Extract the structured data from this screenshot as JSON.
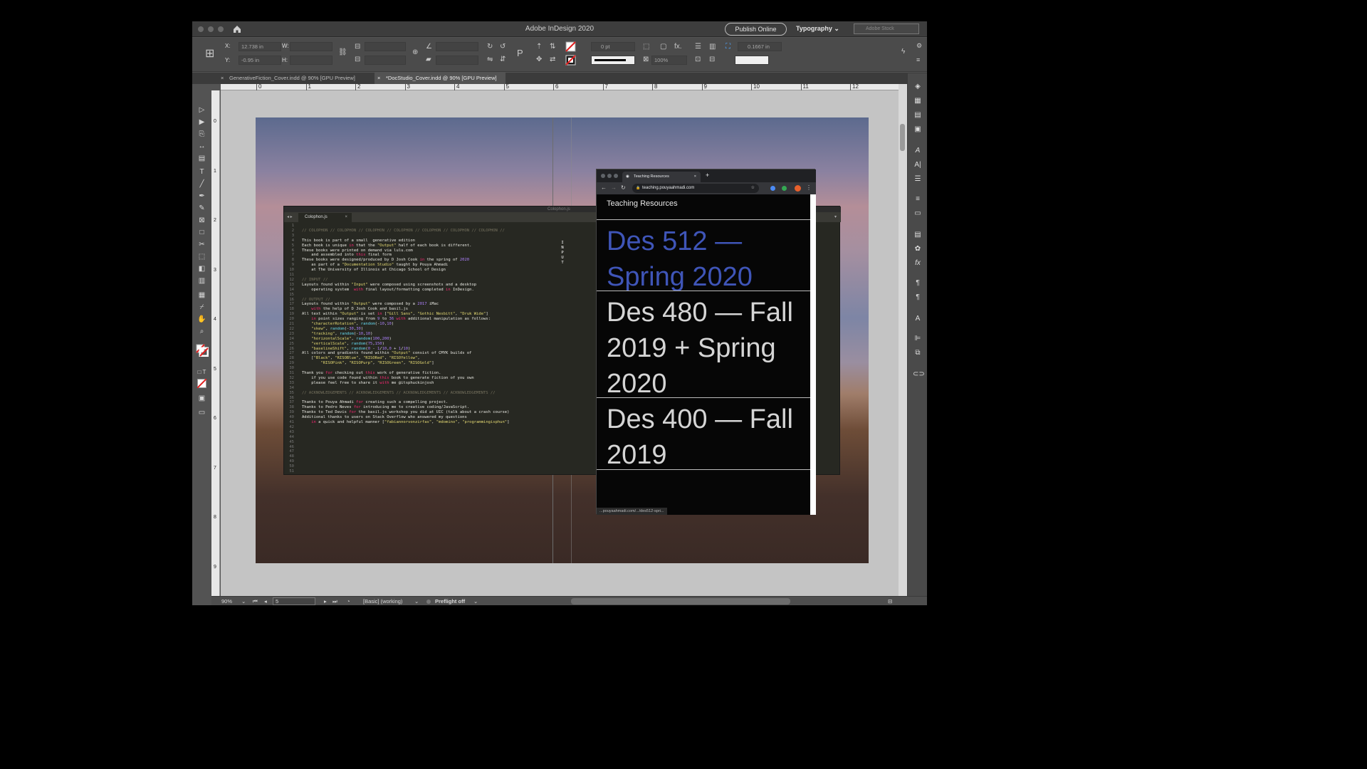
{
  "app": {
    "title": "Adobe InDesign 2020",
    "publish_label": "Publish Online",
    "workspace": "Typography",
    "stock_placeholder": "Adobe Stock"
  },
  "control": {
    "x_label": "X:",
    "x_value": "12.738 in",
    "y_label": "Y:",
    "y_value": "-0.95 in",
    "w_label": "W:",
    "h_label": "H:",
    "stroke_weight": "0 pt",
    "opacity": "100%",
    "offset": "0.1667 in"
  },
  "tabs": [
    {
      "label": "GenerativeFiction_Cover.indd @ 90% [GPU Preview]"
    },
    {
      "label": "*DocStudio_Cover.indd @ 90% [GPU Preview]"
    }
  ],
  "ruler_h": [
    "0",
    "1",
    "2",
    "3",
    "4",
    "5",
    "6",
    "7",
    "8",
    "9",
    "10",
    "11",
    "12"
  ],
  "ruler_v": [
    "0",
    "1",
    "2",
    "3",
    "4",
    "5",
    "6",
    "7",
    "8",
    "9"
  ],
  "editor": {
    "tab": "Colophon.js",
    "file_title": "Colophon.js",
    "input_vertical": "INPUT",
    "lines": [
      "// COLOPHON // COLOPHON // COLOPHON // COLOPHON // COLOPHON // COLOPHON // COLOPHON //",
      "",
      "This book is part of a small  generative edition",
      "Each book is unique in that the \"Output\" half of each book is different.",
      "These books were printed on demand via lulu.com",
      "    and assembled into this final form",
      "These books were designed/produced by D Josh Cook in the spring of 2020",
      "    as part of a \"Documentation Studio\" taught by Pouya Ahmadi",
      "    at The University of Illinois at Chicago School of Design",
      "",
      "// INPUT //",
      "Layouts found within \"Input\" were composed using screenshots and a desktop",
      "    operating system  with final layout/formatting completed in InDesign.",
      "",
      "// OUTPUT //",
      "Layouts found within \"Output\" were composed by a 2017 iMac",
      "    with the help of D Josh Cook and basil.js",
      "All text within \"Output\" is set in [\"Gill Sans\", \"Gothic Nesbitt\", \"Druk Wide\"]",
      "    in point sizes ranging from 9 to 36 with additional manipulation as follows:",
      "    \"characterRotation\", random(-10,10)",
      "    \"skew\", random(-30,30)",
      "    \"tracking\", random(-10,10)",
      "    \"horizontalScale\", random(100,200)",
      "    \"verticalScale\", random(75,150)",
      "    \"baselineShift\", random(0 - 1/10,0 + 1/10)",
      "All colors and gradients found within \"Output\" consist of CMYK builds of",
      "    [\"Black\", \"RISOBlue\", \"RISORed\", \"RISOYellow\",",
      "        \"RISOPink\", \"RISOPurp\", \"RISOGreen\", \"RISOGold\"]",
      "",
      "Thank you for checking out this work of generative fiction.",
      "    if you use code found within this book to generate fiction of you own",
      "    please feel free to share it with me @itsphuckinjosh",
      "",
      "// ACKNOWLEDGEMENTS // ACKNOWLEDGEMENTS // ACKNOWLEDGEMENTS // ACKNOWLEDGEMENTS //",
      "",
      "Thanks to Pouya Ahmadi for creating such a compelling project.",
      "Thanks to Pedro Neves for introducing me to creative coding/JavaScript.",
      "Thanks to Ted Davis for the basil.js workshop you did at UIC (talk about a crash course)",
      "Additional thanks to users on Stack Overflow who answered my questions",
      "    in a quick and helpful manner [\"fabiannorvonzirfas\", \"mdomino\", \"programmingisphun\"]"
    ]
  },
  "browser": {
    "tab_title": "Teaching Resources",
    "url": "teaching.pouyaahmadi.com",
    "page_title": "Teaching Resources",
    "accent": "#3f55b8",
    "courses": [
      {
        "label": "Des 512 — Spring 2020",
        "color": "#3f55b8"
      },
      {
        "label": "Des 480 — Fall 2019 + Spring 2020",
        "color": "#d5d5d5"
      },
      {
        "label": "Des 400 — Fall 2019",
        "color": "#d5d5d5"
      }
    ],
    "status_url": "...pouyaahmadi.com/.../des512-spri..."
  },
  "status": {
    "zoom": "90%",
    "page": "5",
    "style": "[Basic] (working)",
    "preflight": "Preflight off"
  }
}
